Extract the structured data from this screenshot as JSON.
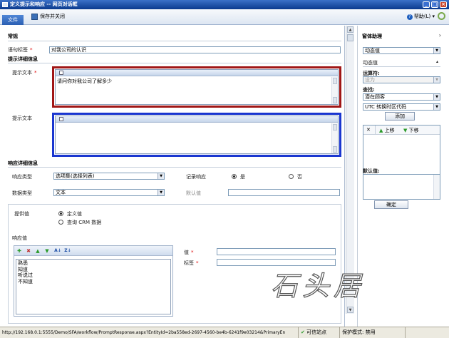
{
  "window": {
    "title": "定义提示和响应 -- 网页对话框",
    "min_glyph": "_",
    "max_glyph": "□",
    "close_glyph": "×"
  },
  "toolbar": {
    "file_tab": "文件",
    "save_close": "保存并关闭",
    "help": "帮助(L)",
    "help_glyph": "?",
    "help_arrow": "▾"
  },
  "general": {
    "section_title": "常规",
    "prompt_label_label": "语句标签",
    "prompt_label_value": "对我公司的认识"
  },
  "prompt_details": {
    "section_title": "提示详细信息",
    "prompt_text_1_label": "提示文本",
    "prompt_text_1_value": "请问你对我公司了解多少",
    "prompt_text_2_label": "提示文本",
    "prompt_text_2_value": ""
  },
  "response_details": {
    "section_title": "响应详细信息",
    "response_type_label": "响应类型",
    "response_type_value": "选项集(选择列表)",
    "log_response_label": "记录响应",
    "yes_label": "是",
    "no_label": "否",
    "data_type_label": "数据类型",
    "data_type_value": "文本",
    "default_value_label": "默认值",
    "default_value": ""
  },
  "provide_values": {
    "label": "提供值",
    "option_define": "定义值",
    "option_query": "查询 CRM 数据",
    "response_values_label": "响应值",
    "value_label": "值",
    "tag_label": "标签",
    "items": [
      "熟悉",
      "知道",
      "听说过",
      "不知道"
    ]
  },
  "assistant": {
    "title": "窗体助理",
    "chevron": "›",
    "top_select": "动态值",
    "dynamic_label": "动态值",
    "dynamic_glyph": "▴",
    "operator_label": "运算符:",
    "operator_value": "设为",
    "lookup_label": "查找:",
    "lookup_value": "潜在顾客",
    "field_value": "UTC 转换时区代码",
    "add_button": "添加",
    "delete_glyph": "✕",
    "move_up": "上移",
    "move_down": "下移",
    "default_label": "默认值:",
    "ok_button": "确定"
  },
  "statusbar": {
    "url": "http://192.168.0.1:5555/Demo/SFA/workflow/PromptResponse.aspx?EntityId=2ba558ed-2697-4560-be4b-6241f9e03214&PrimaryEn",
    "zone": "可信站点",
    "protected_mode": "保护模式: 禁用"
  },
  "watermark": "石头居"
}
